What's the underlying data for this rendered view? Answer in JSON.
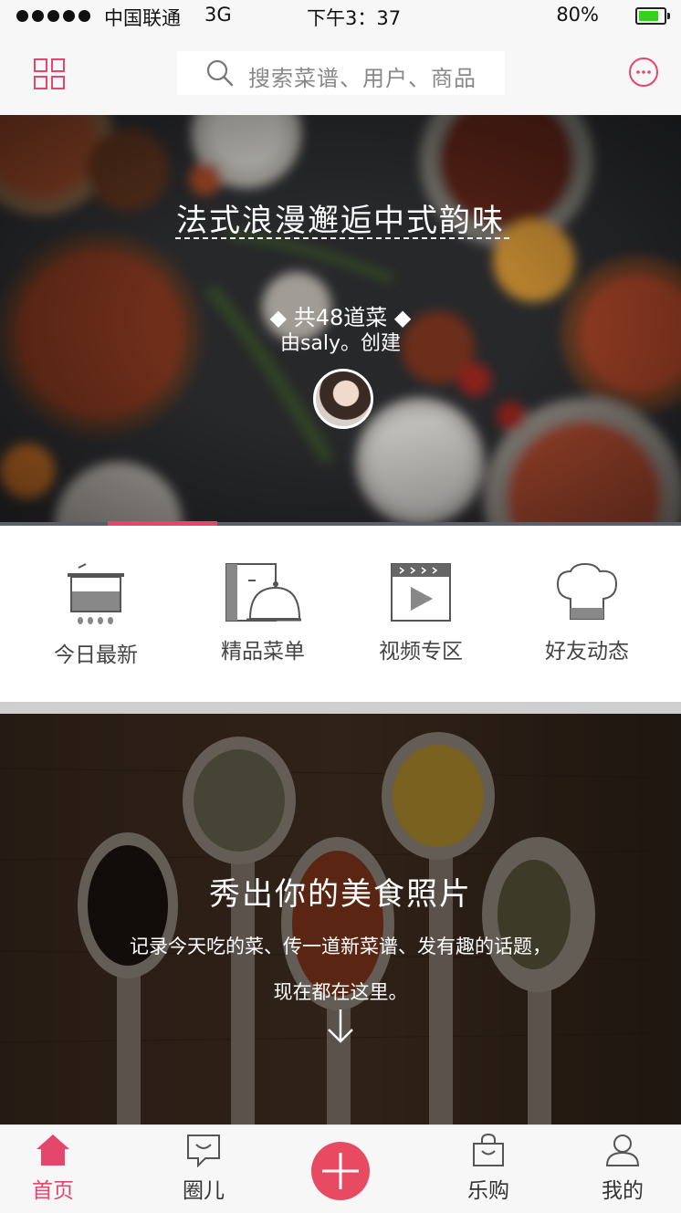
{
  "status_bar": {
    "carrier": "中国联通",
    "network": "3G",
    "time": "下午3：37",
    "battery": "80%"
  },
  "header": {
    "search_placeholder": "搜索菜谱、用户、商品",
    "grid_icon": "grid-icon",
    "message_icon": "message-dots-icon"
  },
  "banner": {
    "title": "法式浪漫邂逅中式韵味",
    "dish_count": "◆ 共48道菜 ◆",
    "creator": "由saly。创建",
    "current_slide_fraction": 0.2
  },
  "categories": [
    {
      "label": "今日最新",
      "icon": "pot-icon"
    },
    {
      "label": "精品菜单",
      "icon": "menu-cloche-icon"
    },
    {
      "label": "视频专区",
      "icon": "video-icon"
    },
    {
      "label": "好友动态",
      "icon": "chef-hat-icon"
    }
  ],
  "promo": {
    "headline": "秀出你的美食照片",
    "line1": "记录今天吃的菜、传一道新菜谱、发有趣的话题，",
    "line2": "现在都在这里。"
  },
  "tabbar": {
    "tabs": [
      {
        "label": "首页",
        "icon": "home-icon",
        "active": true
      },
      {
        "label": "圈儿",
        "icon": "chat-bubble-icon",
        "active": false
      },
      {
        "label": "",
        "icon": "plus-icon",
        "active": false
      },
      {
        "label": "乐购",
        "icon": "shopping-bag-icon",
        "active": false
      },
      {
        "label": "我的",
        "icon": "user-icon",
        "active": false
      }
    ]
  },
  "colors": {
    "accent": "#e5466b",
    "add_button": "#e84a62"
  }
}
